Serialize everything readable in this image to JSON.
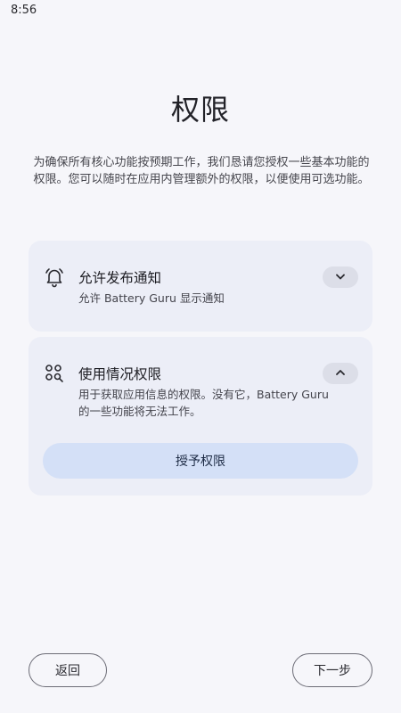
{
  "status_bar": {
    "time": "8:56"
  },
  "page": {
    "title": "权限",
    "intro": "为确保所有核心功能按预期工作，我们恳请您授权一些基本功能的权限。您可以随时在应用内管理额外的权限，以便使用可选功能。"
  },
  "permissions": [
    {
      "icon": "bell-icon",
      "title": "允许发布通知",
      "description": "允许 Battery Guru 显示通知",
      "expanded": false,
      "toggle_icon": "chevron-down-icon"
    },
    {
      "icon": "usage-stats-icon",
      "title": "使用情况权限",
      "description": "用于获取应用信息的权限。没有它，Battery Guru 的一些功能将无法工作。",
      "expanded": true,
      "toggle_icon": "chevron-up-icon",
      "action_label": "授予权限"
    }
  ],
  "footer": {
    "back_label": "返回",
    "next_label": "下一步"
  },
  "colors": {
    "background": "#f6f6fa",
    "card": "#eceef7",
    "primary_tonal": "#d4e0f7",
    "outline": "#6c6c76"
  }
}
